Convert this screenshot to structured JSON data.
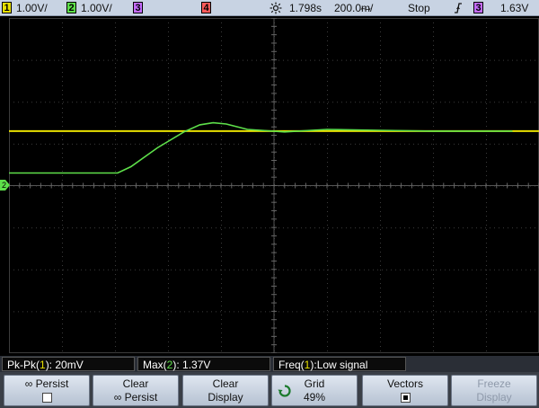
{
  "topbar": {
    "ch1_num": "1",
    "ch1_scale": "1.00V/",
    "ch2_num": "2",
    "ch2_scale": "1.00V/",
    "ch3_num": "3",
    "ch4_num": "4",
    "time_ref_icon": "sun-icon",
    "time_delay": "1.798s",
    "time_scale": "200.0ᵯ/",
    "run_state": "Stop",
    "trigger_icon": "trigger-edge-icon",
    "trigger_source": "3",
    "trigger_level": "1.63V"
  },
  "measurements": {
    "m1_label": "Pk-Pk(",
    "m1_ch": "1",
    "m1_value": "): 20mV",
    "m2_label": "Max(",
    "m2_ch": "2",
    "m2_value": "): 1.37V",
    "m3_label": "Freq(",
    "m3_ch": "1",
    "m3_value": "):Low signal"
  },
  "softkeys": {
    "k1_line1": "∞ Persist",
    "k2_line1": "Clear",
    "k2_line2": "∞ Persist",
    "k3_line1": "Clear",
    "k3_line2": "Display",
    "k4_line1": "Grid",
    "k4_line2": "49%",
    "k5_line1": "Vectors",
    "k6_line1": "Freeze",
    "k6_line2": "Display"
  },
  "colors": {
    "ch1": "#e8e000",
    "ch2": "#5ee04a",
    "ch3": "#c56cff",
    "ch4": "#ff5a5a"
  },
  "chart_data": {
    "type": "line",
    "grid_divisions": {
      "x": 10,
      "y": 8
    },
    "series": [
      {
        "channel": "1",
        "points_div": [
          [
            0,
            2.7
          ],
          [
            10,
            2.7
          ]
        ]
      },
      {
        "channel": "2",
        "points_div": [
          [
            0,
            3.7
          ],
          [
            2.05,
            3.7
          ],
          [
            2.3,
            3.55
          ],
          [
            2.8,
            3.1
          ],
          [
            3.3,
            2.72
          ],
          [
            3.6,
            2.55
          ],
          [
            3.85,
            2.5
          ],
          [
            4.1,
            2.53
          ],
          [
            4.5,
            2.66
          ],
          [
            5.2,
            2.72
          ],
          [
            6.0,
            2.66
          ],
          [
            7.0,
            2.68
          ],
          [
            8.0,
            2.7
          ],
          [
            9.5,
            2.7
          ]
        ]
      }
    ],
    "ground_marker_div": 3.0
  }
}
